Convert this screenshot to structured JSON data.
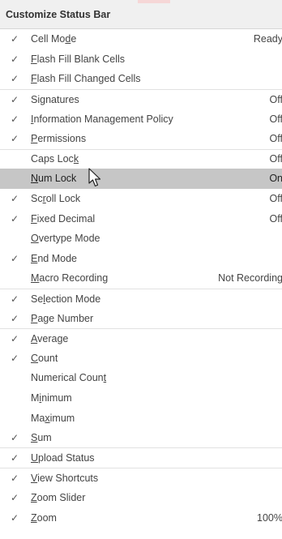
{
  "menu": {
    "title": "Customize Status Bar",
    "items": [
      {
        "checked": true,
        "pre": "Cell Mo",
        "key": "d",
        "post": "e",
        "value": "Ready",
        "sep": false
      },
      {
        "checked": true,
        "pre": "",
        "key": "F",
        "post": "lash Fill Blank Cells",
        "value": "",
        "sep": false
      },
      {
        "checked": true,
        "pre": "",
        "key": "F",
        "post": "lash Fill Changed Cells",
        "value": "",
        "sep": false
      },
      {
        "checked": true,
        "pre": "Si",
        "key": "g",
        "post": "natures",
        "value": "Off",
        "sep": true
      },
      {
        "checked": true,
        "pre": "",
        "key": "I",
        "post": "nformation Management Policy",
        "value": "Off",
        "sep": false
      },
      {
        "checked": true,
        "pre": "",
        "key": "P",
        "post": "ermissions",
        "value": "Off",
        "sep": false
      },
      {
        "checked": false,
        "pre": "Caps Loc",
        "key": "k",
        "post": "",
        "value": "Off",
        "sep": true
      },
      {
        "checked": false,
        "pre": "",
        "key": "N",
        "post": "um Lock",
        "value": "On",
        "sep": false,
        "hover": true
      },
      {
        "checked": true,
        "pre": "Sc",
        "key": "r",
        "post": "oll Lock",
        "value": "Off",
        "sep": false
      },
      {
        "checked": true,
        "pre": "",
        "key": "F",
        "post": "ixed Decimal",
        "value": "Off",
        "sep": false
      },
      {
        "checked": false,
        "pre": "",
        "key": "O",
        "post": "vertype Mode",
        "value": "",
        "sep": false
      },
      {
        "checked": true,
        "pre": "",
        "key": "E",
        "post": "nd Mode",
        "value": "",
        "sep": false
      },
      {
        "checked": false,
        "pre": "",
        "key": "M",
        "post": "acro Recording",
        "value": "Not Recording",
        "sep": false
      },
      {
        "checked": true,
        "pre": "Se",
        "key": "l",
        "post": "ection Mode",
        "value": "",
        "sep": true
      },
      {
        "checked": true,
        "pre": "",
        "key": "P",
        "post": "age Number",
        "value": "",
        "sep": false
      },
      {
        "checked": true,
        "pre": "",
        "key": "A",
        "post": "verage",
        "value": "",
        "sep": true
      },
      {
        "checked": true,
        "pre": "",
        "key": "C",
        "post": "ount",
        "value": "",
        "sep": false
      },
      {
        "checked": false,
        "pre": "Numerical Coun",
        "key": "t",
        "post": "",
        "value": "",
        "sep": false
      },
      {
        "checked": false,
        "pre": "M",
        "key": "i",
        "post": "nimum",
        "value": "",
        "sep": false
      },
      {
        "checked": false,
        "pre": "Ma",
        "key": "x",
        "post": "imum",
        "value": "",
        "sep": false
      },
      {
        "checked": true,
        "pre": "",
        "key": "S",
        "post": "um",
        "value": "",
        "sep": false
      },
      {
        "checked": true,
        "pre": "",
        "key": "U",
        "post": "pload Status",
        "value": "",
        "sep": true
      },
      {
        "checked": true,
        "pre": "",
        "key": "V",
        "post": "iew Shortcuts",
        "value": "",
        "sep": true
      },
      {
        "checked": true,
        "pre": "",
        "key": "Z",
        "post": "oom Slider",
        "value": "",
        "sep": false
      },
      {
        "checked": true,
        "pre": "",
        "key": "Z",
        "post": "oom",
        "value": "100%",
        "sep": false
      }
    ],
    "check_glyph": "✓",
    "colors": {
      "header_bg": "#f0f0f0",
      "hover_bg": "#c6c6c6",
      "text": "#444444",
      "accent": "#f6d7d7"
    },
    "cursor_icon": "arrow-pointer-icon"
  }
}
